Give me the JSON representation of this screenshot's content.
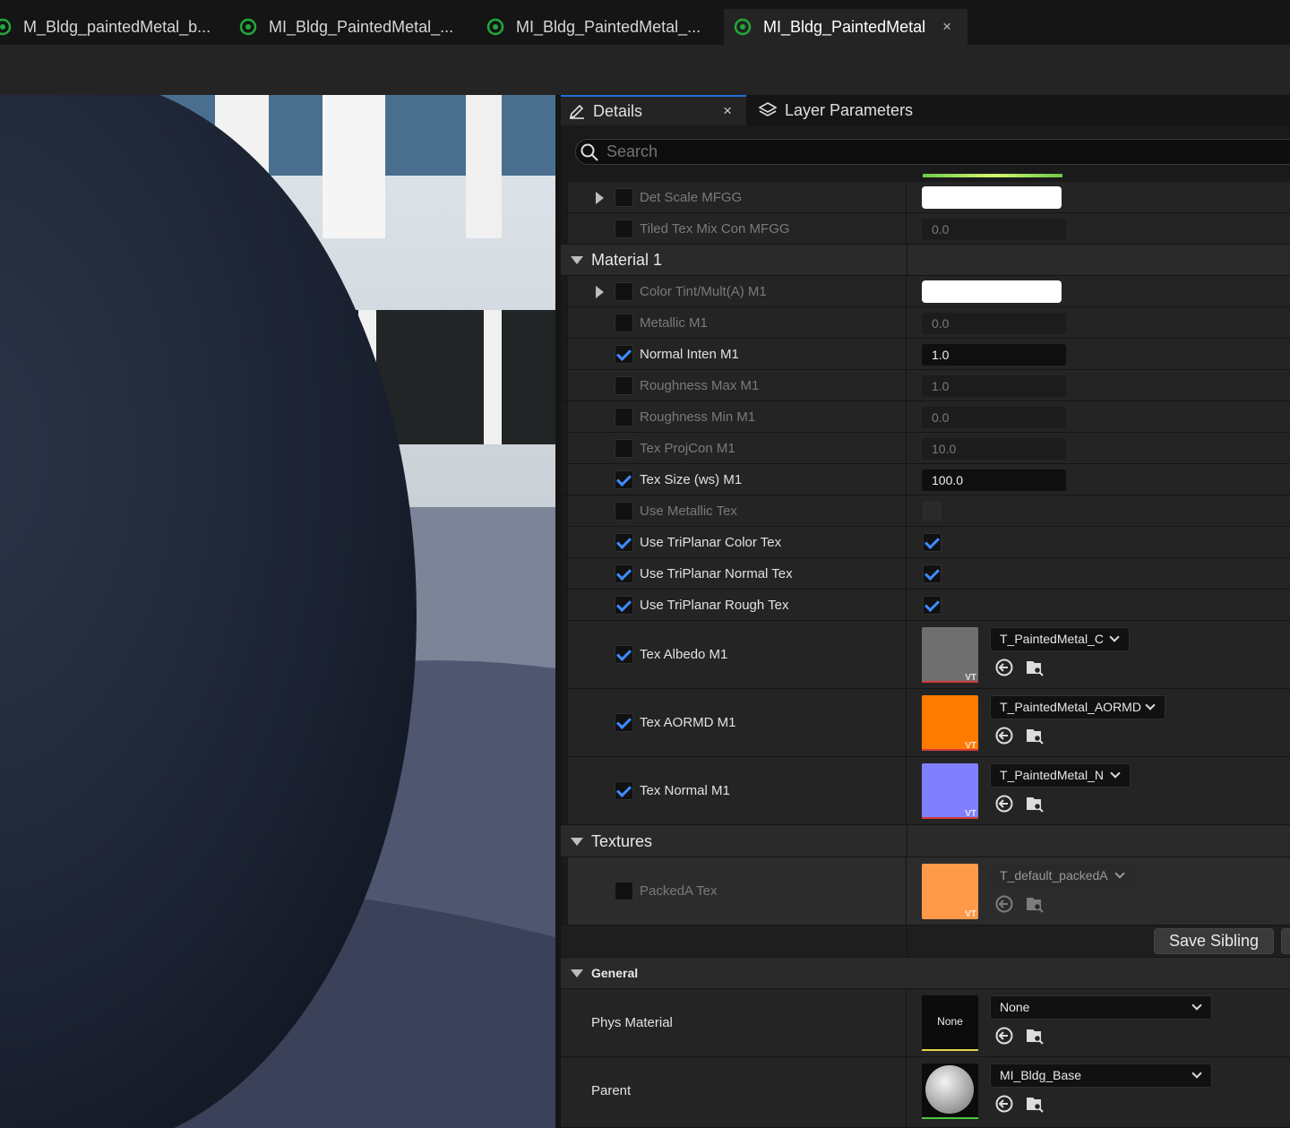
{
  "tabs": [
    {
      "label": "M_Bldg_paintedMetal_b...",
      "active": false
    },
    {
      "label": "MI_Bldg_PaintedMetal_...",
      "active": false
    },
    {
      "label": "MI_Bldg_PaintedMetal_...",
      "active": false
    },
    {
      "label": "MI_Bldg_PaintedMetal",
      "active": true,
      "close": "×"
    }
  ],
  "panel": {
    "details_tab": "Details",
    "details_close": "×",
    "layers_tab": "Layer Parameters",
    "search_placeholder": "Search"
  },
  "rows": {
    "det_scale": {
      "label": "Det Scale MFGG"
    },
    "tiled_tex": {
      "label": "Tiled Tex Mix Con MFGG",
      "value": "0.0"
    },
    "cat_material1": "Material 1",
    "color_tint": {
      "label": "Color Tint/Mult(A) M1"
    },
    "metallic": {
      "label": "Metallic M1",
      "value": "0.0"
    },
    "normal_inten": {
      "label": "Normal Inten M1",
      "value": "1.0"
    },
    "rough_max": {
      "label": "Roughness Max M1",
      "value": "1.0"
    },
    "rough_min": {
      "label": "Roughness Min M1",
      "value": "0.0"
    },
    "tex_projcon": {
      "label": "Tex ProjCon M1",
      "value": "10.0"
    },
    "tex_size": {
      "label": "Tex Size (ws) M1",
      "value": "100.0"
    },
    "use_metallic": {
      "label": "Use Metallic Tex"
    },
    "use_tri_color": {
      "label": "Use TriPlanar Color Tex"
    },
    "use_tri_normal": {
      "label": "Use TriPlanar Normal Tex"
    },
    "use_tri_rough": {
      "label": "Use TriPlanar Rough Tex"
    },
    "tex_albedo": {
      "label": "Tex Albedo M1",
      "asset": "T_PaintedMetal_C",
      "badge": "VT",
      "color": "#6f6f6f"
    },
    "tex_aormd": {
      "label": "Tex AORMD M1",
      "asset": "T_PaintedMetal_AORMD",
      "badge": "VT",
      "color": "#ff7a00"
    },
    "tex_normal": {
      "label": "Tex Normal M1",
      "asset": "T_PaintedMetal_N",
      "badge": "VT",
      "color": "#8080ff"
    },
    "cat_textures": "Textures",
    "packed_tex": {
      "label": "PackedA Tex",
      "asset": "T_default_packedA",
      "badge": "VT",
      "color": "#ff9a4a"
    },
    "save_sibling": "Save Sibling",
    "cat_general": "General",
    "phys_material": {
      "label": "Phys Material",
      "thumb_text": "None",
      "asset": "None"
    },
    "parent": {
      "label": "Parent",
      "asset": "MI_Bldg_Base"
    }
  },
  "colors": {
    "accent": "#3d8cff",
    "panel_bg": "#242424",
    "tab_icon": "#1faa3a"
  }
}
